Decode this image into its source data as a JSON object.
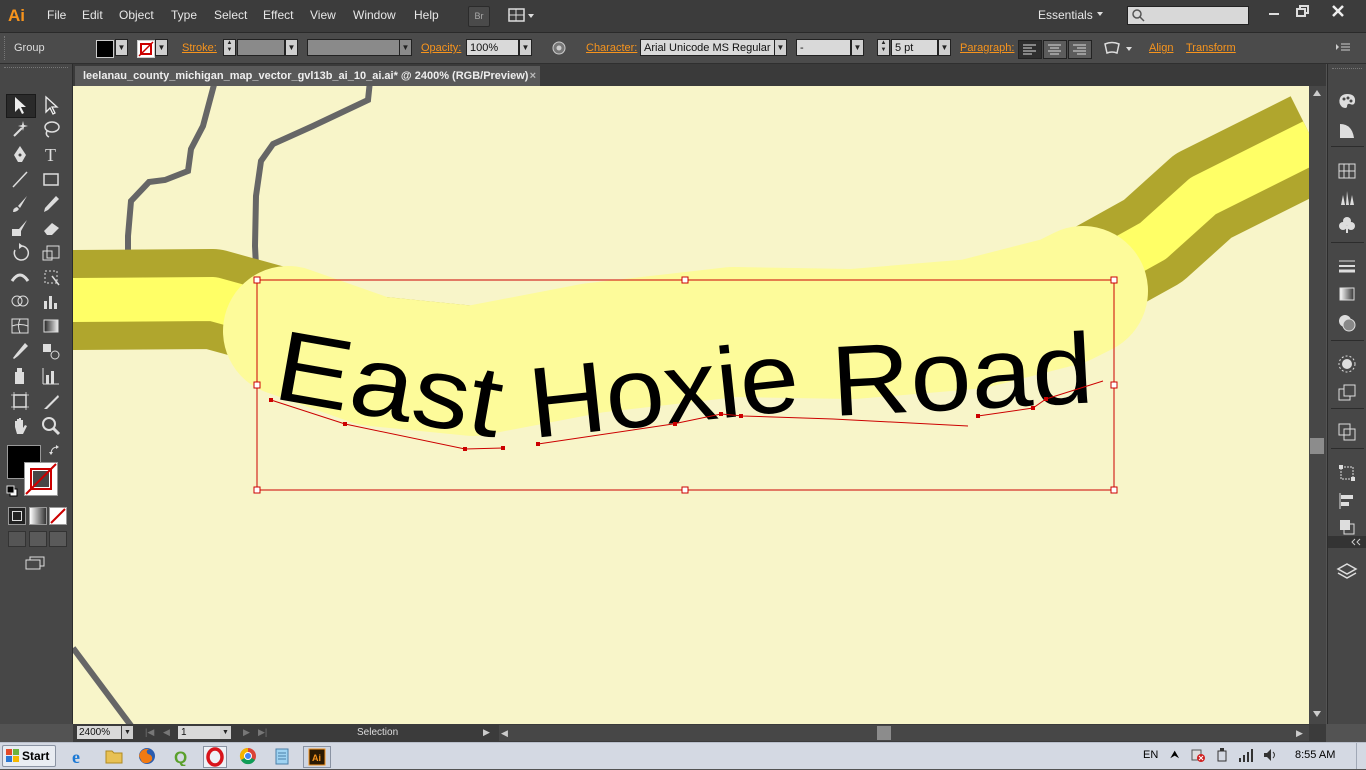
{
  "app": {
    "logo": "Ai"
  },
  "menu": [
    "File",
    "Edit",
    "Object",
    "Type",
    "Select",
    "Effect",
    "View",
    "Window",
    "Help"
  ],
  "bridge_label": "Br",
  "workspace": "Essentials",
  "control": {
    "selection_type": "Group",
    "stroke_label": "Stroke:",
    "opacity_label": "Opacity:",
    "opacity_value": "100%",
    "character_label": "Character:",
    "font_family": "Arial Unicode MS Regular",
    "font_style": "-",
    "font_size": "5 pt",
    "paragraph_label": "Paragraph:",
    "align_label": "Align",
    "transform_label": "Transform"
  },
  "document": {
    "tab_title": "leelanau_county_michigan_map_vector_gvl13b_ai_10_ai.ai* @ 2400% (RGB/Preview)",
    "close_glyph": "×"
  },
  "canvas": {
    "label_text": "East Hoxie Road",
    "colors": {
      "background": "#f8f5c9",
      "road_outer": "#b0a62d",
      "road_inner": "#ffff66",
      "label_halo": "#fdfb9a",
      "boundary": "#666666",
      "selection": "#cc0000"
    }
  },
  "status": {
    "zoom": "2400%",
    "page": "1",
    "tool": "Selection"
  },
  "taskbar": {
    "start_label": "Start",
    "language": "EN",
    "time": "8:55 AM",
    "apps": [
      "ie-icon",
      "explorer-icon",
      "firefox-icon",
      "qgis-icon",
      "opera-icon",
      "chrome-icon",
      "notepad-icon",
      "illustrator-icon"
    ]
  }
}
